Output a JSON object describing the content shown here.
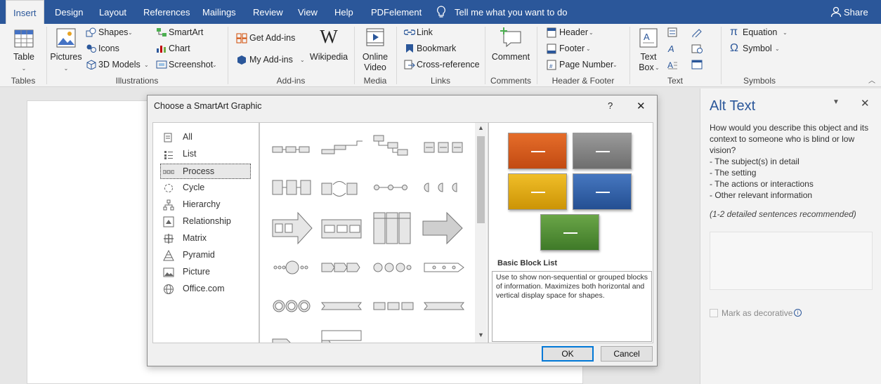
{
  "tabs": [
    "Insert",
    "Design",
    "Layout",
    "References",
    "Mailings",
    "Review",
    "View",
    "Help",
    "PDFelement"
  ],
  "tell_me": "Tell me what you want to do",
  "share": "Share",
  "ribbon": {
    "table": "Table",
    "pictures": "Pictures",
    "shapes": "Shapes",
    "icons": "Icons",
    "models3d": "3D Models",
    "smartart": "SmartArt",
    "chart": "Chart",
    "screenshot": "Screenshot",
    "get_addins": "Get Add-ins",
    "my_addins": "My Add-ins",
    "wikipedia": "Wikipedia",
    "online_video_1": "Online",
    "online_video_2": "Video",
    "link": "Link",
    "bookmark": "Bookmark",
    "cross_reference": "Cross-reference",
    "comment": "Comment",
    "header": "Header",
    "footer": "Footer",
    "page_number": "Page Number",
    "text_box_1": "Text",
    "text_box_2": "Box",
    "equation": "Equation",
    "symbol": "Symbol",
    "groups": {
      "tables": "Tables",
      "illustrations": "Illustrations",
      "addins": "Add-ins",
      "media": "Media",
      "links": "Links",
      "comments": "Comments",
      "header_footer": "Header & Footer",
      "text": "Text",
      "symbols": "Symbols"
    }
  },
  "dialog": {
    "title": "Choose a SmartArt Graphic",
    "help": "?",
    "close": "✕",
    "categories": [
      "All",
      "List",
      "Process",
      "Cycle",
      "Hierarchy",
      "Relationship",
      "Matrix",
      "Pyramid",
      "Picture",
      "Office.com"
    ],
    "selected_category": "Process",
    "preview_title": "Basic Block List",
    "preview_desc": "Use to show non-sequential or grouped blocks of information. Maximizes both horizontal and vertical display space for shapes.",
    "ok": "OK",
    "cancel": "Cancel",
    "block_colors": [
      "#d65a1e",
      "#7f7f7f",
      "#e0a80c",
      "#2e5fa3",
      "#4f8a34"
    ]
  },
  "alt_text": {
    "title": "Alt Text",
    "question": "How would you describe this object and its context to someone who is blind or low vision?",
    "points": [
      "- The subject(s) in detail",
      "- The setting",
      "- The actions or interactions",
      "- Other relevant information"
    ],
    "hint": "(1-2 detailed sentences recommended)",
    "decorative": "Mark as decorative",
    "info": "i"
  },
  "colors": {
    "accent": "#2b579a"
  }
}
